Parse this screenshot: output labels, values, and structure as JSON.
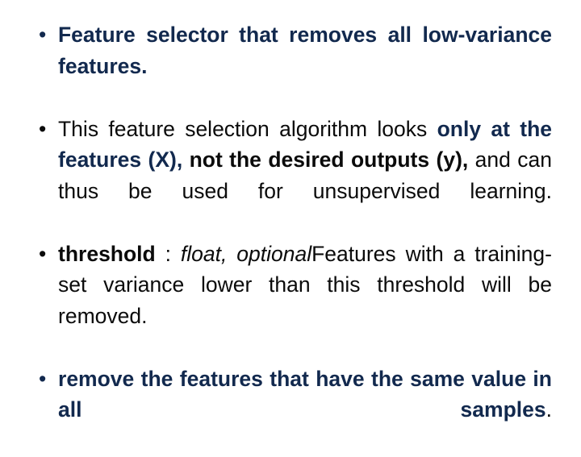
{
  "slide": {
    "background_color": "#ffffff",
    "accent_blue": "#12294e",
    "body_black": "#0b0b0b",
    "bullet_glyph": "•",
    "bullets": [
      {
        "id": "bullet-feature-selector",
        "marker_color": "blue",
        "plain_text": "Feature selector that removes all low-variance features.",
        "runs": [
          {
            "text": "Feature selector that removes all low-variance features.",
            "style": "blue-bold"
          }
        ]
      },
      {
        "id": "bullet-feature-selection-algorithm",
        "marker_color": "black",
        "plain_text": "This feature selection algorithm looks only at the features (X), not the desired outputs (y), and can thus be used for unsupervised learning.",
        "runs": [
          {
            "text": "This feature selection algorithm looks ",
            "style": "black"
          },
          {
            "text": "only at the features (X),",
            "style": "blue-bold"
          },
          {
            "text": " not the desired outputs (y),",
            "style": "black-bold"
          },
          {
            "text": " and can thus be used for unsupervised learning.",
            "style": "black"
          }
        ]
      },
      {
        "id": "bullet-threshold",
        "marker_color": "black",
        "plain_text": "threshold : float, optionalFeatures with a training-set variance lower than this threshold will be removed.",
        "runs": [
          {
            "text": "threshold",
            "style": "black-bold"
          },
          {
            "text": " : ",
            "style": "black"
          },
          {
            "text": "float,  optional",
            "style": "black-italic"
          },
          {
            "text": "Features with a training-set variance lower than this threshold will be removed.",
            "style": "black"
          }
        ]
      },
      {
        "id": "bullet-remove-same-value",
        "marker_color": "blue",
        "plain_text": "remove the features that have the same value in all samples.",
        "runs": [
          {
            "text": "remove the features that have the same value in all samples",
            "style": "blue-bold"
          },
          {
            "text": ".",
            "style": "black"
          }
        ]
      }
    ]
  }
}
